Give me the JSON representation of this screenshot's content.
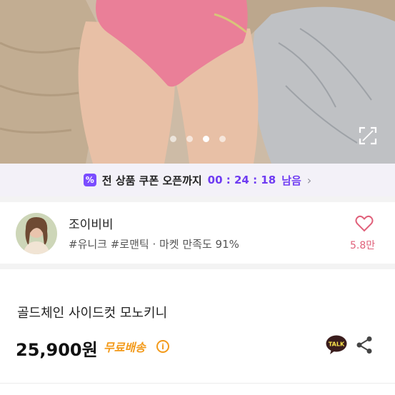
{
  "gallery": {
    "page_count": 4,
    "current_page": 3
  },
  "coupon_bar": {
    "text": "전 상품 쿠폰 오픈까지",
    "timer": "00 : 24 : 18",
    "suffix": "남음",
    "chevron": "›",
    "icon": "coupon-percent-icon",
    "accent": "#6f3cf2"
  },
  "shop": {
    "name": "조이비비",
    "tags": "#유니크 #로맨틱 · 마켓 만족도 91%",
    "likes": "5.8만",
    "heart_color": "#e0607a"
  },
  "product": {
    "title": "골드체인 사이드컷 모노키니",
    "price": "25,900원",
    "shipping": "무료배송",
    "shipping_color": "#f39a1a",
    "talk_label": "TALK"
  }
}
